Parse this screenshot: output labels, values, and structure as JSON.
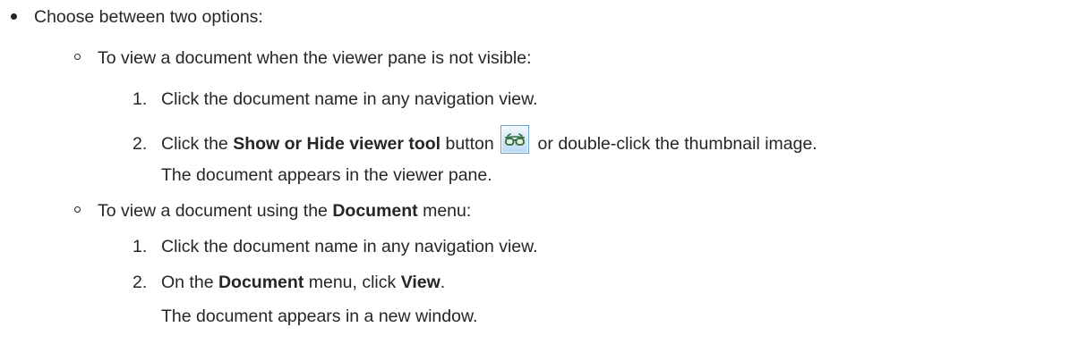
{
  "intro": {
    "text": "Choose between two options:"
  },
  "option_viewer": {
    "text": "To view a document when the viewer pane is not visible:",
    "step1": {
      "number": "1.",
      "text": "Click the document name in any navigation view."
    },
    "step2": {
      "number": "2.",
      "prefix": "Click the ",
      "bold": "Show or Hide viewer tool",
      "middle": " button",
      "suffix": " or double-click the thumbnail image.",
      "result": "The document appears in the viewer pane."
    },
    "icon": "show-hide-viewer-glasses-icon"
  },
  "option_menu": {
    "prefix": "To view a document using the ",
    "bold": "Document",
    "suffix": " menu:",
    "step1": {
      "number": "1.",
      "text": "Click the document name in any navigation view."
    },
    "step2": {
      "number": "2.",
      "prefix": "On the ",
      "bold_menu": "Document",
      "middle": " menu, click ",
      "bold_action": "View",
      "suffix": ".",
      "result": "The document appears in a new window."
    }
  }
}
